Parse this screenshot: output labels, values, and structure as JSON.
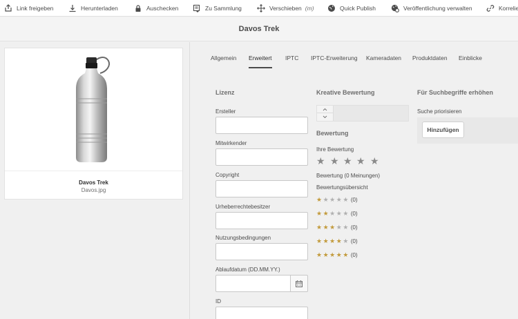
{
  "toolbar": {
    "items": [
      {
        "label": "Link freigeben",
        "icon": "share-icon"
      },
      {
        "label": "Herunterladen",
        "icon": "download-icon"
      },
      {
        "label": "Auschecken",
        "icon": "lock-icon"
      },
      {
        "label": "Zu Sammlung",
        "icon": "add-to-collection-icon"
      },
      {
        "label": "Verschieben",
        "shortcut": "(m)",
        "icon": "move-icon"
      },
      {
        "label": "Quick Publish",
        "icon": "globe-icon"
      },
      {
        "label": "Veröffentlichung verwalten",
        "icon": "globe-gear-icon"
      },
      {
        "label": "Korrelieren",
        "icon": "link-icon"
      }
    ]
  },
  "header": {
    "title": "Davos Trek"
  },
  "asset": {
    "name": "Davos Trek",
    "filename": "Davos.jpg"
  },
  "tabs": [
    "Allgemein",
    "Erweitert",
    "IPTC",
    "IPTC-Erweiterung",
    "Kameradaten",
    "Produktdaten",
    "Einblicke"
  ],
  "active_tab": "Erweitert",
  "license": {
    "title": "Lizenz",
    "fields": [
      {
        "label": "Ersteller",
        "value": ""
      },
      {
        "label": "Mitwirkender",
        "value": ""
      },
      {
        "label": "Copyright",
        "value": ""
      },
      {
        "label": "Urheberrechtebesitzer",
        "value": ""
      },
      {
        "label": "Nutzungsbedingungen",
        "value": ""
      }
    ],
    "expiry_label": "Ablaufdatum (DD.MM.YY.)",
    "expiry_value": "",
    "id_label": "ID"
  },
  "creative_rating": {
    "title": "Kreative Bewertung",
    "value": ""
  },
  "rating": {
    "title": "Bewertung",
    "your_rating_label": "Ihre Bewertung",
    "your_rating": 0,
    "summary_text": "Bewertung (0 Meinungen)",
    "overview_label": "Bewertungsübersicht",
    "rows": [
      {
        "stars": 1,
        "count": "(0)"
      },
      {
        "stars": 2,
        "count": "(0)"
      },
      {
        "stars": 3,
        "count": "(0)"
      },
      {
        "stars": 4,
        "count": "(0)"
      },
      {
        "stars": 5,
        "count": "(0)"
      }
    ]
  },
  "search_boost": {
    "title": "Für Suchbegriffe erhöhen",
    "label": "Suche priorisieren",
    "button": "Hinzufügen"
  },
  "colors": {
    "star_on": "#c29a3b",
    "star_off": "#b0b0b0",
    "background": "#f0f0f0"
  }
}
